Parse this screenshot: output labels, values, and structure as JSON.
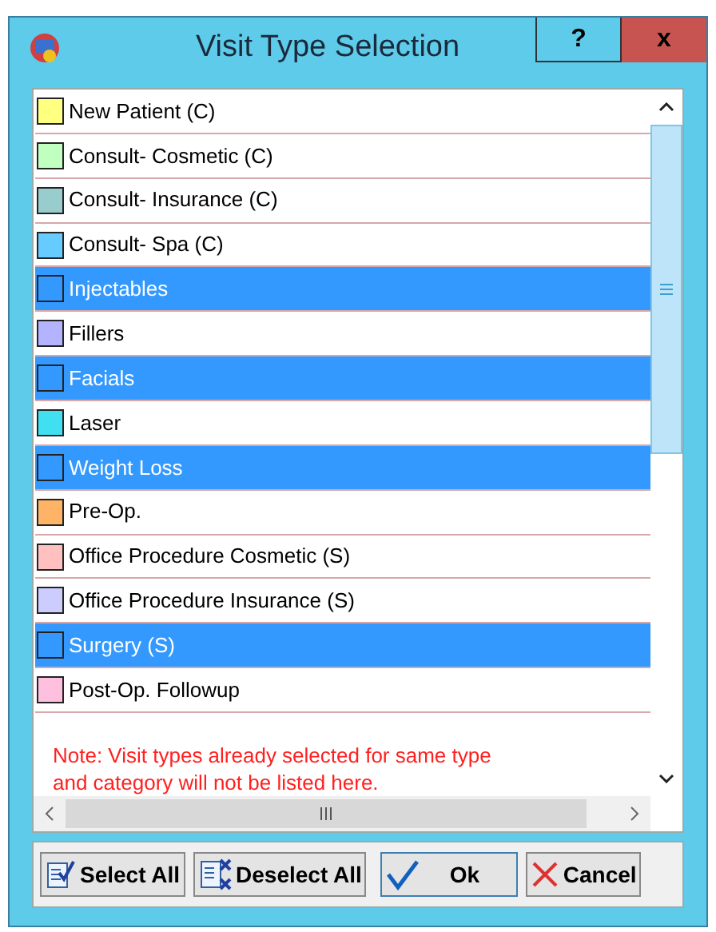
{
  "window": {
    "title": "Visit Type Selection",
    "help": "?",
    "close": "x"
  },
  "items": [
    {
      "label": "New Patient (C)",
      "color": "#ffff80",
      "selected": false
    },
    {
      "label": "Consult- Cosmetic (C)",
      "color": "#c0ffc0",
      "selected": false
    },
    {
      "label": "Consult- Insurance (C)",
      "color": "#99cccc",
      "selected": false
    },
    {
      "label": "Consult- Spa (C)",
      "color": "#66ccff",
      "selected": false
    },
    {
      "label": "Injectables",
      "color": "#3399ff",
      "selected": true
    },
    {
      "label": "Fillers",
      "color": "#b3b3ff",
      "selected": false
    },
    {
      "label": "Facials",
      "color": "#3399ff",
      "selected": true
    },
    {
      "label": "Laser",
      "color": "#40e0f0",
      "selected": false
    },
    {
      "label": "Weight Loss",
      "color": "#3399ff",
      "selected": true
    },
    {
      "label": "Pre-Op.",
      "color": "#ffb366",
      "selected": false
    },
    {
      "label": "Office Procedure Cosmetic (S)",
      "color": "#ffc0c0",
      "selected": false
    },
    {
      "label": "Office Procedure Insurance (S)",
      "color": "#ccccff",
      "selected": false
    },
    {
      "label": "Surgery (S)",
      "color": "#3399ff",
      "selected": true
    },
    {
      "label": "Post-Op. Followup",
      "color": "#ffc0e0",
      "selected": false
    }
  ],
  "note": "Note: Visit types already selected for same type and category will not be listed here.",
  "buttons": [
    {
      "label": "Select All",
      "kind": "select"
    },
    {
      "label": "Deselect All",
      "kind": "deselect"
    },
    {
      "label": "Ok",
      "kind": "ok"
    },
    {
      "label": "Cancel",
      "kind": "cancel"
    }
  ]
}
